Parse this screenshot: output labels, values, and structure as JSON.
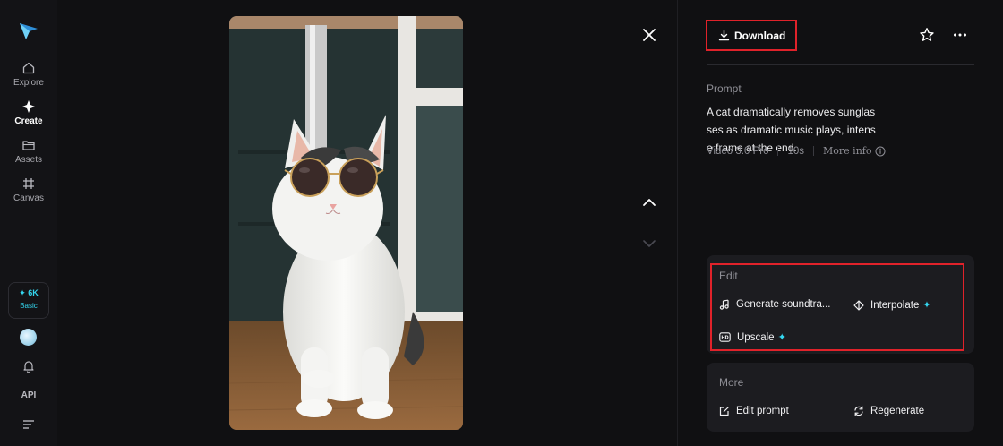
{
  "sidebar": {
    "nav": [
      {
        "label": "Explore",
        "icon": "home-icon"
      },
      {
        "label": "Create",
        "icon": "sparkle-icon"
      },
      {
        "label": "Assets",
        "icon": "folder-icon"
      },
      {
        "label": "Canvas",
        "icon": "canvas-icon"
      }
    ],
    "credits": {
      "value": "6K",
      "plan": "Basic"
    },
    "api_label": "API"
  },
  "toolbar": {
    "download_label": "Download"
  },
  "details": {
    "prompt_label": "Prompt",
    "prompt_text": "A cat dramatically removes sunglasses as dramatic music plays, intense frame at the end.",
    "model": "Video 3.0 Pro",
    "duration": "10s",
    "more_info_label": "More info"
  },
  "edit_section": {
    "title": "Edit",
    "actions": [
      {
        "label": "Generate soundtra...",
        "icon": "music-note-icon",
        "premium": false
      },
      {
        "label": "Interpolate",
        "icon": "interpolate-icon",
        "premium": true
      },
      {
        "label": "Upscale",
        "icon": "hd-icon",
        "premium": true
      }
    ]
  },
  "more_section": {
    "title": "More",
    "actions": [
      {
        "label": "Edit prompt",
        "icon": "edit-prompt-icon"
      },
      {
        "label": "Regenerate",
        "icon": "regenerate-icon"
      }
    ]
  },
  "colors": {
    "accent": "#34d7f0",
    "highlight_border": "#e0222a",
    "background": "#101012",
    "card": "#1c1c20"
  }
}
